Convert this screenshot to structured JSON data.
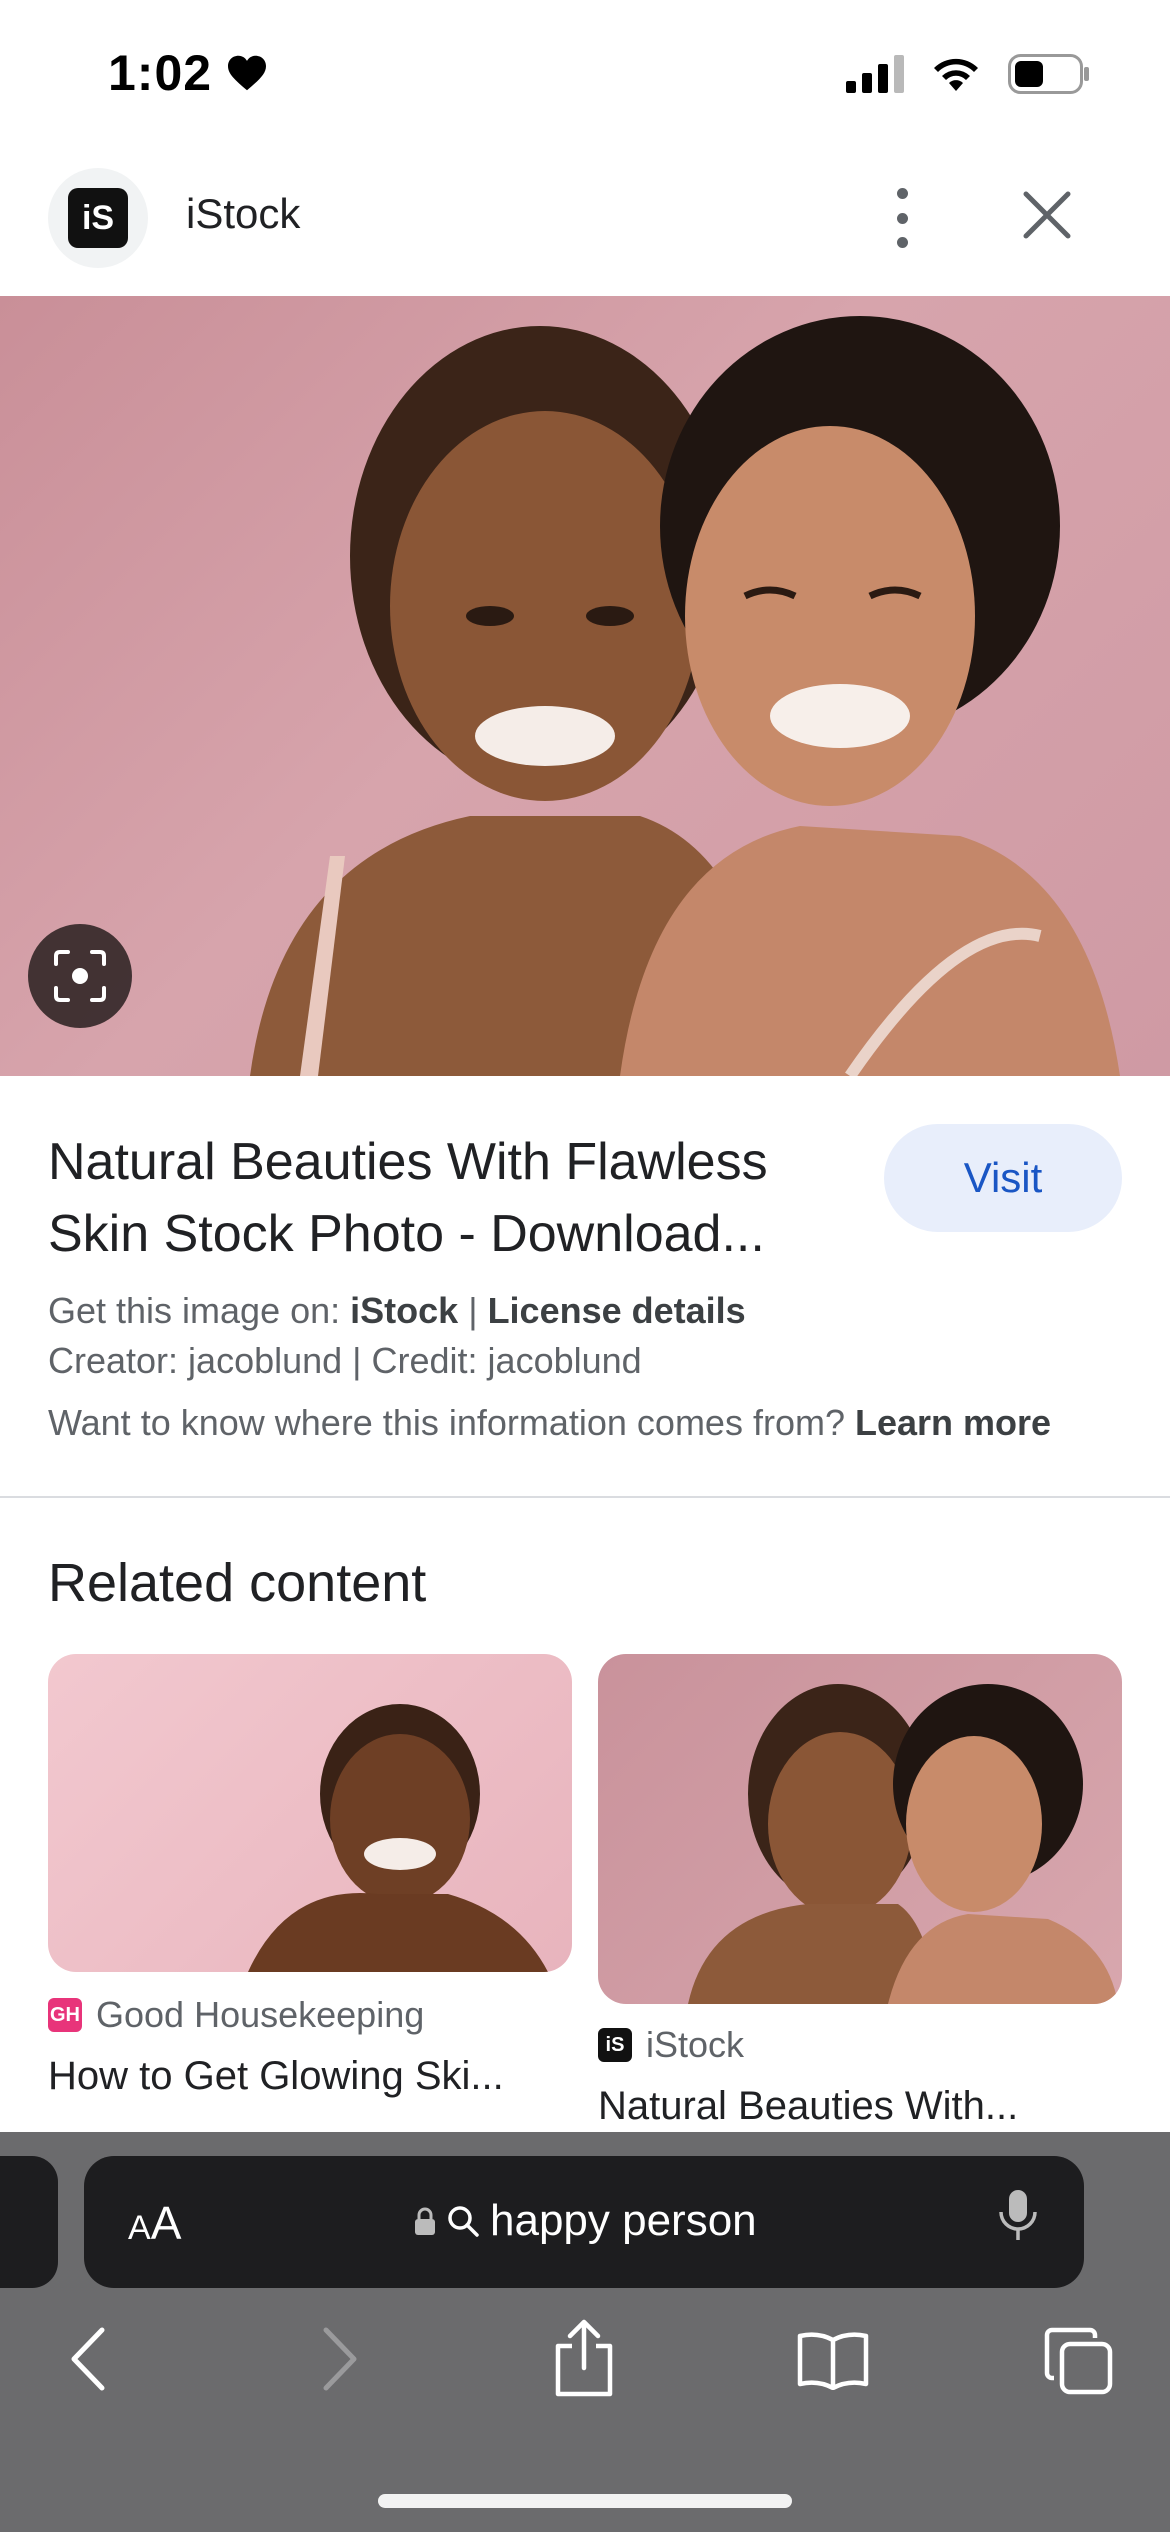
{
  "status_bar": {
    "time": "1:02"
  },
  "header": {
    "site_icon_text": "iS",
    "site_name": "iStock"
  },
  "hero": {
    "alt_icon": "lens-icon"
  },
  "result": {
    "title_line1": "Natural Beauties With Flawless",
    "title_line2": "Skin Stock Photo - Download...",
    "visit_label": "Visit",
    "get_image_prefix": "Get this image on: ",
    "get_image_source": "iStock",
    "separator": " | ",
    "license_label": "License details",
    "creator_line": "Creator: jacoblund | Credit: jacoblund",
    "info_prefix": "Want to know where this information comes from? ",
    "learn_more": "Learn more"
  },
  "related": {
    "title": "Related content",
    "items": [
      {
        "source_icon": "GH",
        "source": "Good Housekeeping",
        "caption": "How to Get Glowing Ski...",
        "icon_color": "#e8347a"
      },
      {
        "source_icon": "iS",
        "source": "iStock",
        "caption": "Natural Beauties With...",
        "icon_color": "#111111"
      }
    ]
  },
  "address_bar": {
    "aa_small": "A",
    "aa_large": "A",
    "query": "happy person"
  },
  "colors": {
    "accent": "#1a56c4",
    "visit_bg": "#e8eefb",
    "chrome_bg": "#6b6b6d",
    "address_bg": "#1d1d1f"
  }
}
